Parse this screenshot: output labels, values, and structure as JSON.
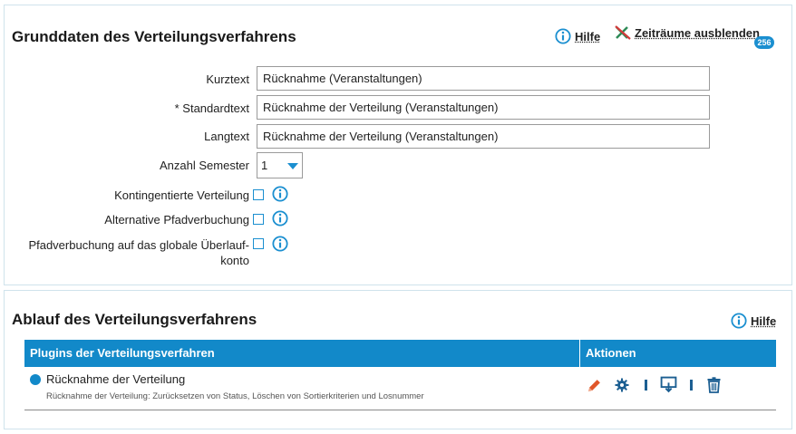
{
  "section1": {
    "title": "Grunddaten des Verteilungsverfahrens",
    "help_label": "Hilfe",
    "hide_periods_label": "Zeiträume ausblenden",
    "badge": "256",
    "fields": {
      "kurztext_label": "Kurztext",
      "kurztext_value": "Rücknahme (Veranstaltungen)",
      "standardtext_label": "* Standardtext",
      "standardtext_value": "Rücknahme der Verteilung (Veranstaltungen)",
      "langtext_label": "Langtext",
      "langtext_value": "Rücknahme der Verteilung (Veranstaltungen)",
      "semester_label": "Anzahl Semester",
      "semester_value": "1"
    },
    "checkboxes": {
      "kontingent_label": "Kontingentierte Verteilung",
      "alt_pfad_label": "Alternative Pfadverbuchung",
      "global_line1": "Pfadverbuchung auf das globale Überlauf-",
      "global_line2": "konto"
    }
  },
  "section2": {
    "title": "Ablauf des Verteilungsverfahrens",
    "help_label": "Hilfe",
    "table": {
      "col_plugins": "Plugins der Verteilungsverfahren",
      "col_actions": "Aktionen",
      "rows": [
        {
          "name": "Rücknahme der Verteilung",
          "description": "Rücknahme der Verteilung: Zurücksetzen von Status, Löschen von Sortierkriterien und Losnummer"
        }
      ]
    }
  },
  "colors": {
    "accent": "#1b8fd0",
    "header_bg": "#1289c9",
    "edit": "#e0562a",
    "action": "#1c5f92"
  }
}
